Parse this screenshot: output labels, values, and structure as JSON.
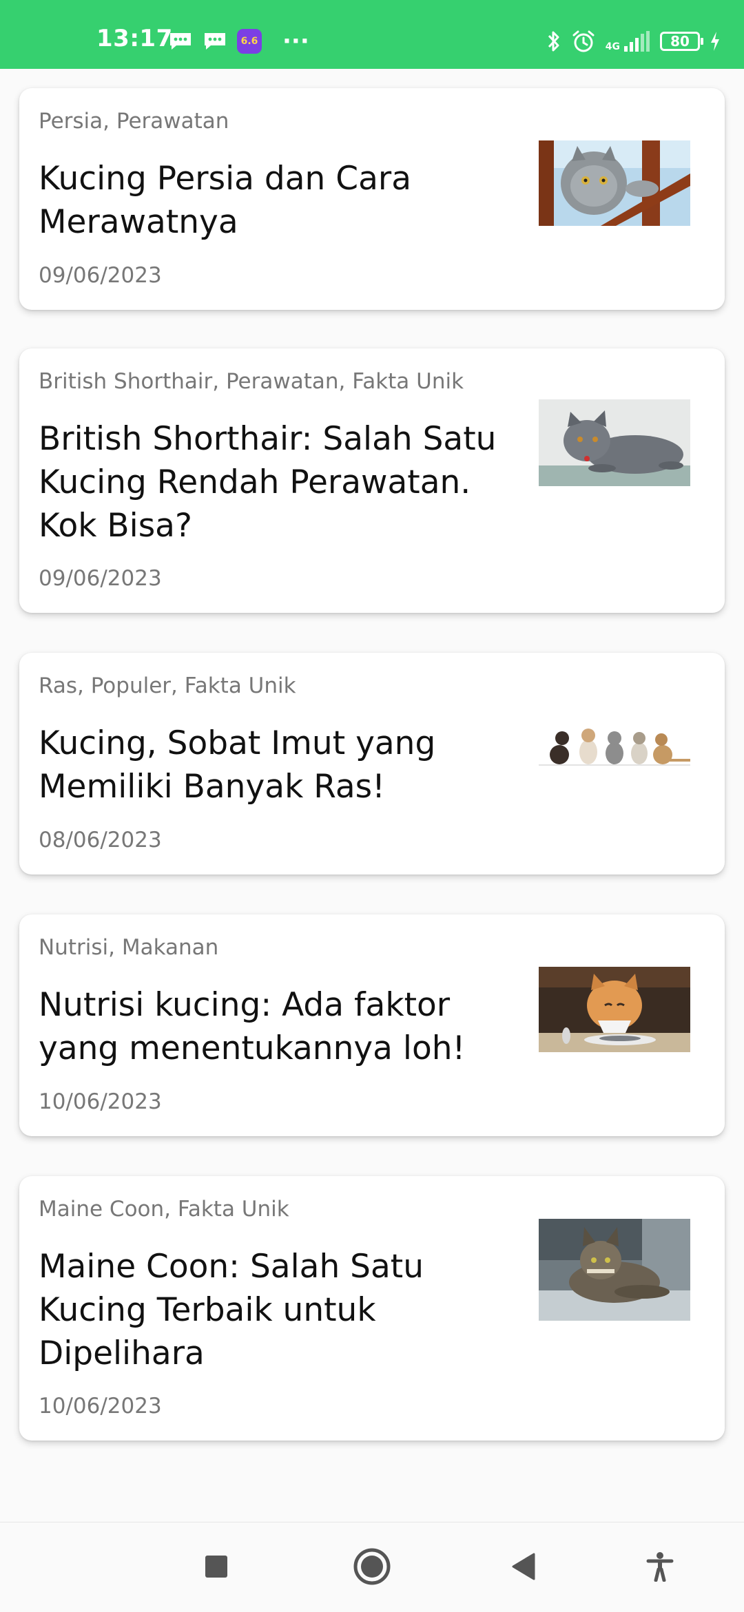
{
  "status_bar": {
    "time": "13:17",
    "app_badge": "6.6",
    "network": "4G",
    "battery": "80",
    "color": "#36d06f"
  },
  "articles": [
    {
      "tags": "Persia, Perawatan",
      "title": "Kucing Persia dan Cara Merawatnya",
      "date": "09/06/2023",
      "image": "grey-persian-cat-on-chair-photo"
    },
    {
      "tags": "British Shorthair, Perawatan, Fakta Unik",
      "title": "British Shorthair: Salah Satu Kucing Rendah Perawatan. Kok Bisa?",
      "date": "09/06/2023",
      "image": "british-shorthair-lying-photo"
    },
    {
      "tags": "Ras, Populer, Fakta Unik",
      "title": "Kucing, Sobat Imut yang Memiliki Banyak Ras!",
      "date": "08/06/2023",
      "image": "row-of-cats-photo"
    },
    {
      "tags": "Nutrisi, Makanan",
      "title": "Nutrisi kucing: Ada faktor yang menentukannya loh!",
      "date": "10/06/2023",
      "image": "cat-with-dinner-plate-photo"
    },
    {
      "tags": "Maine Coon, Fakta Unik",
      "title": "Maine Coon: Salah Satu Kucing Terbaik untuk Dipelihara",
      "date": "10/06/2023",
      "image": "maine-coon-lying-photo"
    }
  ],
  "nav_bar": {
    "buttons": [
      "recents-square-icon",
      "home-circle-icon",
      "back-triangle-icon",
      "accessibility-icon"
    ]
  }
}
